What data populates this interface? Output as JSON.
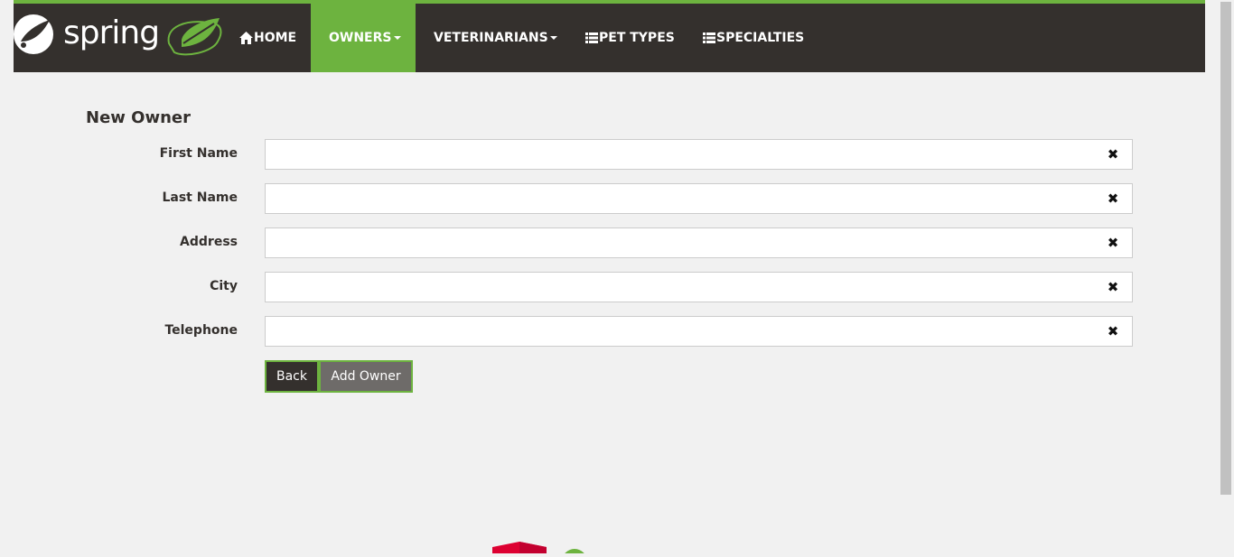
{
  "brand": {
    "name": "spring"
  },
  "nav": {
    "items": [
      {
        "label": "HOME",
        "icon": "home-icon"
      },
      {
        "label": "OWNERS",
        "icon": "caret-down-icon"
      },
      {
        "label": "VETERINARIANS",
        "icon": "caret-down-icon"
      },
      {
        "label": "PET TYPES",
        "icon": "list-icon"
      },
      {
        "label": "SPECIALTIES",
        "icon": "list-icon"
      }
    ]
  },
  "form": {
    "title": "New Owner",
    "fields": [
      {
        "label": "First Name",
        "value": ""
      },
      {
        "label": "Last Name",
        "value": ""
      },
      {
        "label": "Address",
        "value": ""
      },
      {
        "label": "City",
        "value": ""
      },
      {
        "label": "Telephone",
        "value": ""
      }
    ],
    "clear_glyph": "✖",
    "back_label": "Back",
    "add_label": "Add Owner"
  },
  "colors": {
    "nav_bg": "#34302d",
    "accent": "#6db33f",
    "page_bg": "#f1f1f1"
  }
}
